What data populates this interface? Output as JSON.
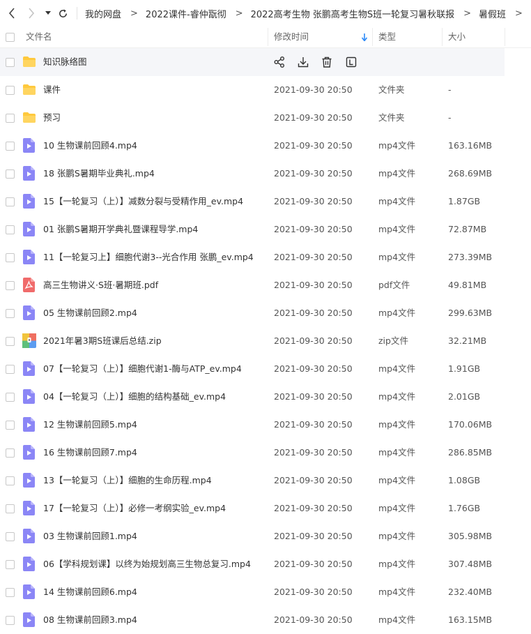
{
  "breadcrumb": {
    "items": [
      "我的网盘",
      "2022课件-睿仲翫彻",
      "2022高考生物 张鹏高考生物S班一轮复习暑秋联报",
      "暑假班"
    ],
    "separator": ">"
  },
  "columns": {
    "name": "文件名",
    "modified": "修改时间",
    "type": "类型",
    "size": "大小"
  },
  "files": [
    {
      "name": "知识脉络图",
      "date": "",
      "type": "",
      "size": "",
      "icon": "folder-icon"
    },
    {
      "name": "课件",
      "date": "2021-09-30 20:50",
      "type": "文件夹",
      "size": "-",
      "icon": "folder-icon"
    },
    {
      "name": "预习",
      "date": "2021-09-30 20:50",
      "type": "文件夹",
      "size": "-",
      "icon": "folder-icon"
    },
    {
      "name": "10 生物课前回顾4.mp4",
      "date": "2021-09-30 20:50",
      "type": "mp4文件",
      "size": "163.16MB",
      "icon": "video-file-icon"
    },
    {
      "name": "18 张鹏S暑期毕业典礼.mp4",
      "date": "2021-09-30 20:50",
      "type": "mp4文件",
      "size": "268.69MB",
      "icon": "video-file-icon"
    },
    {
      "name": "15【一轮复习（上）】减数分裂与受精作用_ev.mp4",
      "date": "2021-09-30 20:50",
      "type": "mp4文件",
      "size": "1.87GB",
      "icon": "video-file-icon"
    },
    {
      "name": "01 张鹏S暑期开学典礼暨课程导学.mp4",
      "date": "2021-09-30 20:50",
      "type": "mp4文件",
      "size": "72.87MB",
      "icon": "video-file-icon"
    },
    {
      "name": "11【一轮复习上】细胞代谢3--光合作用  张鹏_ev.mp4",
      "date": "2021-09-30 20:50",
      "type": "mp4文件",
      "size": "273.39MB",
      "icon": "video-file-icon"
    },
    {
      "name": "高三生物讲义·S班·暑期班.pdf",
      "date": "2021-09-30 20:50",
      "type": "pdf文件",
      "size": "49.81MB",
      "icon": "pdf-file-icon"
    },
    {
      "name": "05 生物课前回顾2.mp4",
      "date": "2021-09-30 20:50",
      "type": "mp4文件",
      "size": "299.63MB",
      "icon": "video-file-icon"
    },
    {
      "name": "2021年暑3期S班课后总结.zip",
      "date": "2021-09-30 20:50",
      "type": "zip文件",
      "size": "32.21MB",
      "icon": "zip-file-icon"
    },
    {
      "name": "07【一轮复习（上）】细胞代谢1-酶与ATP_ev.mp4",
      "date": "2021-09-30 20:50",
      "type": "mp4文件",
      "size": "1.91GB",
      "icon": "video-file-icon"
    },
    {
      "name": "04【一轮复习（上）】细胞的结构基础_ev.mp4",
      "date": "2021-09-30 20:50",
      "type": "mp4文件",
      "size": "2.01GB",
      "icon": "video-file-icon"
    },
    {
      "name": "12 生物课前回顾5.mp4",
      "date": "2021-09-30 20:50",
      "type": "mp4文件",
      "size": "170.06MB",
      "icon": "video-file-icon"
    },
    {
      "name": "16 生物课前回顾7.mp4",
      "date": "2021-09-30 20:50",
      "type": "mp4文件",
      "size": "286.85MB",
      "icon": "video-file-icon"
    },
    {
      "name": "13【一轮复习（上）】细胞的生命历程.mp4",
      "date": "2021-09-30 20:50",
      "type": "mp4文件",
      "size": "1.08GB",
      "icon": "video-file-icon"
    },
    {
      "name": "17【一轮复习（上）】必修一考纲实验_ev.mp4",
      "date": "2021-09-30 20:50",
      "type": "mp4文件",
      "size": "1.76GB",
      "icon": "video-file-icon"
    },
    {
      "name": "03 生物课前回顾1.mp4",
      "date": "2021-09-30 20:50",
      "type": "mp4文件",
      "size": "305.98MB",
      "icon": "video-file-icon"
    },
    {
      "name": "06【学科规划课】以终为始规划高三生物总复习.mp4",
      "date": "2021-09-30 20:50",
      "type": "mp4文件",
      "size": "307.48MB",
      "icon": "video-file-icon"
    },
    {
      "name": "14 生物课前回顾6.mp4",
      "date": "2021-09-30 20:50",
      "type": "mp4文件",
      "size": "232.40MB",
      "icon": "video-file-icon"
    },
    {
      "name": "08 生物课前回顾3.mp4",
      "date": "2021-09-30 20:50",
      "type": "mp4文件",
      "size": "163.15MB",
      "icon": "video-file-icon"
    }
  ],
  "row_actions": [
    "share-icon",
    "download-icon",
    "delete-icon",
    "rename-icon"
  ],
  "colors": {
    "folder": "#ffc93d",
    "video": "#8b86f6",
    "pdf": "#f06b6b",
    "sort_arrow": "#2c8af8",
    "hover_row": "#f5f6f9"
  }
}
